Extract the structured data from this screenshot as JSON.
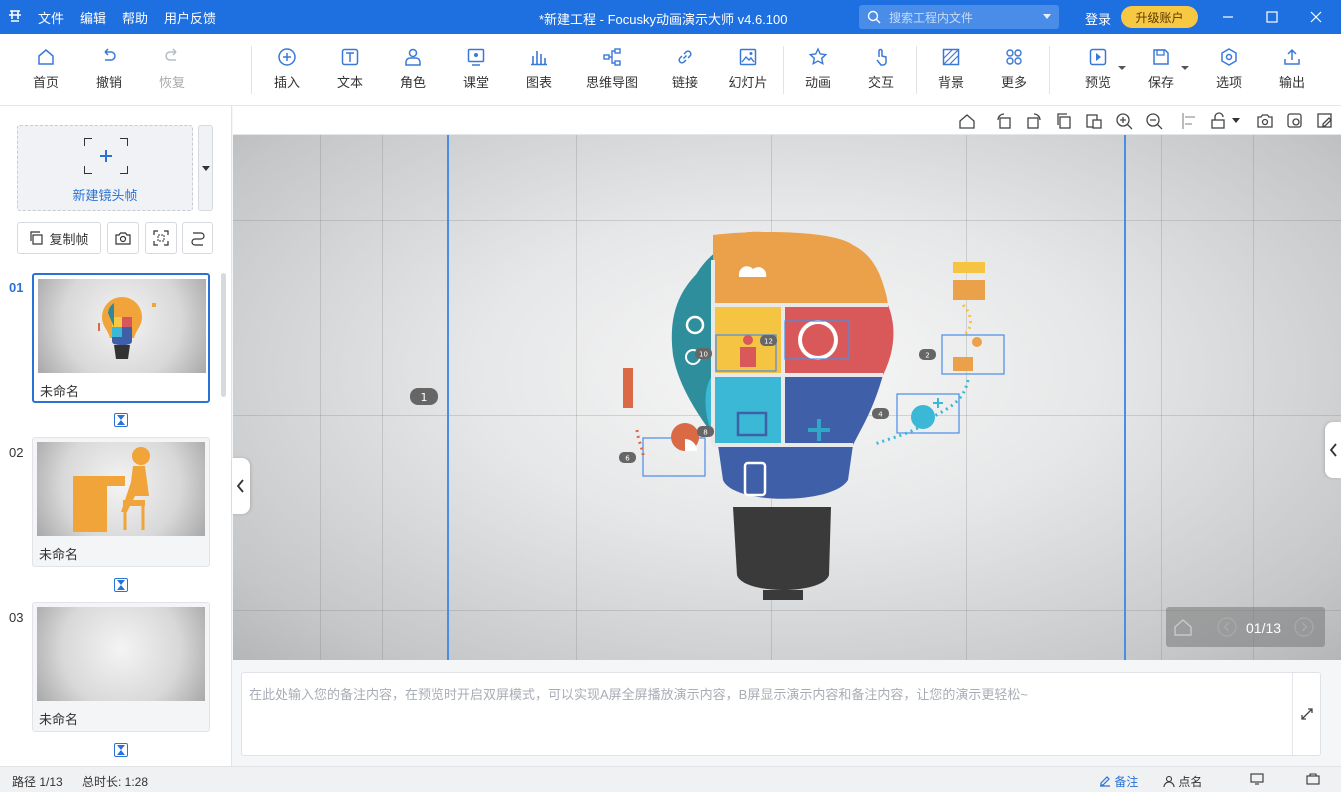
{
  "titlebar": {
    "logo_icon": "app-logo-icon",
    "menu": [
      "文件",
      "编辑",
      "帮助",
      "用户反馈"
    ],
    "title": "*新建工程 - Focusky动画演示大师  v4.6.100",
    "search_placeholder": "搜索工程内文件",
    "login": "登录",
    "upgrade": "升级账户"
  },
  "toolbar": {
    "home": "首页",
    "undo": "撤销",
    "redo": "恢复",
    "insert": "插入",
    "text": "文本",
    "role": "角色",
    "class": "课堂",
    "chart": "图表",
    "mindmap": "思维导图",
    "link": "链接",
    "slide": "幻灯片",
    "animation": "动画",
    "interact": "交互",
    "background": "背景",
    "more": "更多",
    "preview": "预览",
    "save": "保存",
    "options": "选项",
    "export": "输出"
  },
  "left": {
    "new_frame": "新建镜头帧",
    "copy_frame": "复制帧",
    "slides": [
      {
        "num": "01",
        "name": "未命名"
      },
      {
        "num": "02",
        "name": "未命名"
      },
      {
        "num": "03",
        "name": "未命名"
      }
    ]
  },
  "stage": {
    "path_markers": [
      "1",
      "2",
      "4",
      "6",
      "8",
      "10",
      "12"
    ],
    "nav_counter": "01/13"
  },
  "notes": {
    "placeholder": "在此处输入您的备注内容，在预览时开启双屏模式，可以实现A屏全屏播放演示内容，B屏显示演示内容和备注内容，让您的演示更轻松~"
  },
  "status": {
    "path": "路径 1/13",
    "duration": "总时长: 1:28",
    "notes_btn": "备注",
    "rollcall_btn": "点名"
  },
  "colors": {
    "brand": "#1e6fe0",
    "upgrade": "#f7c843",
    "accent": "#2a72d6"
  }
}
